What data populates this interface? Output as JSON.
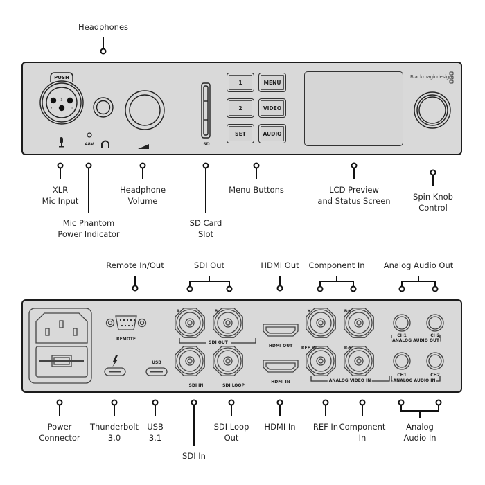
{
  "front": {
    "callouts": {
      "headphones": "Headphones",
      "xlr": [
        "XLR",
        "Mic Input"
      ],
      "phantom": [
        "Mic Phantom",
        "Power Indicator"
      ],
      "hp_volume": [
        "Headphone",
        "Volume"
      ],
      "sd_slot": [
        "SD Card",
        "Slot"
      ],
      "menu_buttons": "Menu Buttons",
      "lcd": [
        "LCD Preview",
        "and Status Screen"
      ],
      "spin_knob": [
        "Spin Knob",
        "Control"
      ]
    },
    "panel": {
      "xlr_push": "PUSH",
      "xlr_pins": [
        "2",
        "3",
        "1"
      ],
      "phantom_label": "48V",
      "sd_label": "SD",
      "buttons": [
        "1",
        "MENU",
        "2",
        "VIDEO",
        "SET",
        "AUDIO"
      ],
      "brand": "Blackmagicdesign"
    }
  },
  "rear": {
    "callouts_top": {
      "remote": "Remote In/Out",
      "sdi_out": "SDI Out",
      "hdmi_out": "HDMI Out",
      "component_in": "Component In",
      "analog_out": "Analog Audio Out"
    },
    "callouts_bottom": {
      "power": [
        "Power",
        "Connector"
      ],
      "thunderbolt": [
        "Thunderbolt",
        "3.0"
      ],
      "usb": [
        "USB",
        "3.1"
      ],
      "sdi_in": "SDI In",
      "sdi_loop": [
        "SDI Loop",
        "Out"
      ],
      "hdmi_in": "HDMI In",
      "ref_in": "REF In",
      "component": [
        "Component",
        "In"
      ],
      "analog_in": [
        "Analog",
        "Audio In"
      ]
    },
    "panel": {
      "remote": "REMOTE",
      "usb": "USB",
      "sdi_a": "A",
      "sdi_b": "B",
      "sdi_out": "SDI OUT",
      "sdi_in": "SDI IN",
      "sdi_loop": "SDI LOOP",
      "hdmi_out": "HDMI OUT",
      "hdmi_in": "HDMI IN",
      "y": "Y",
      "by": "B-Y",
      "ref_in": "REF IN",
      "ry": "R-Y",
      "analog_video_in": "ANALOG VIDEO IN",
      "ch1": "CH1",
      "ch2": "CH2",
      "analog_audio_out": "ANALOG AUDIO OUT",
      "analog_audio_in": "ANALOG AUDIO IN"
    }
  }
}
